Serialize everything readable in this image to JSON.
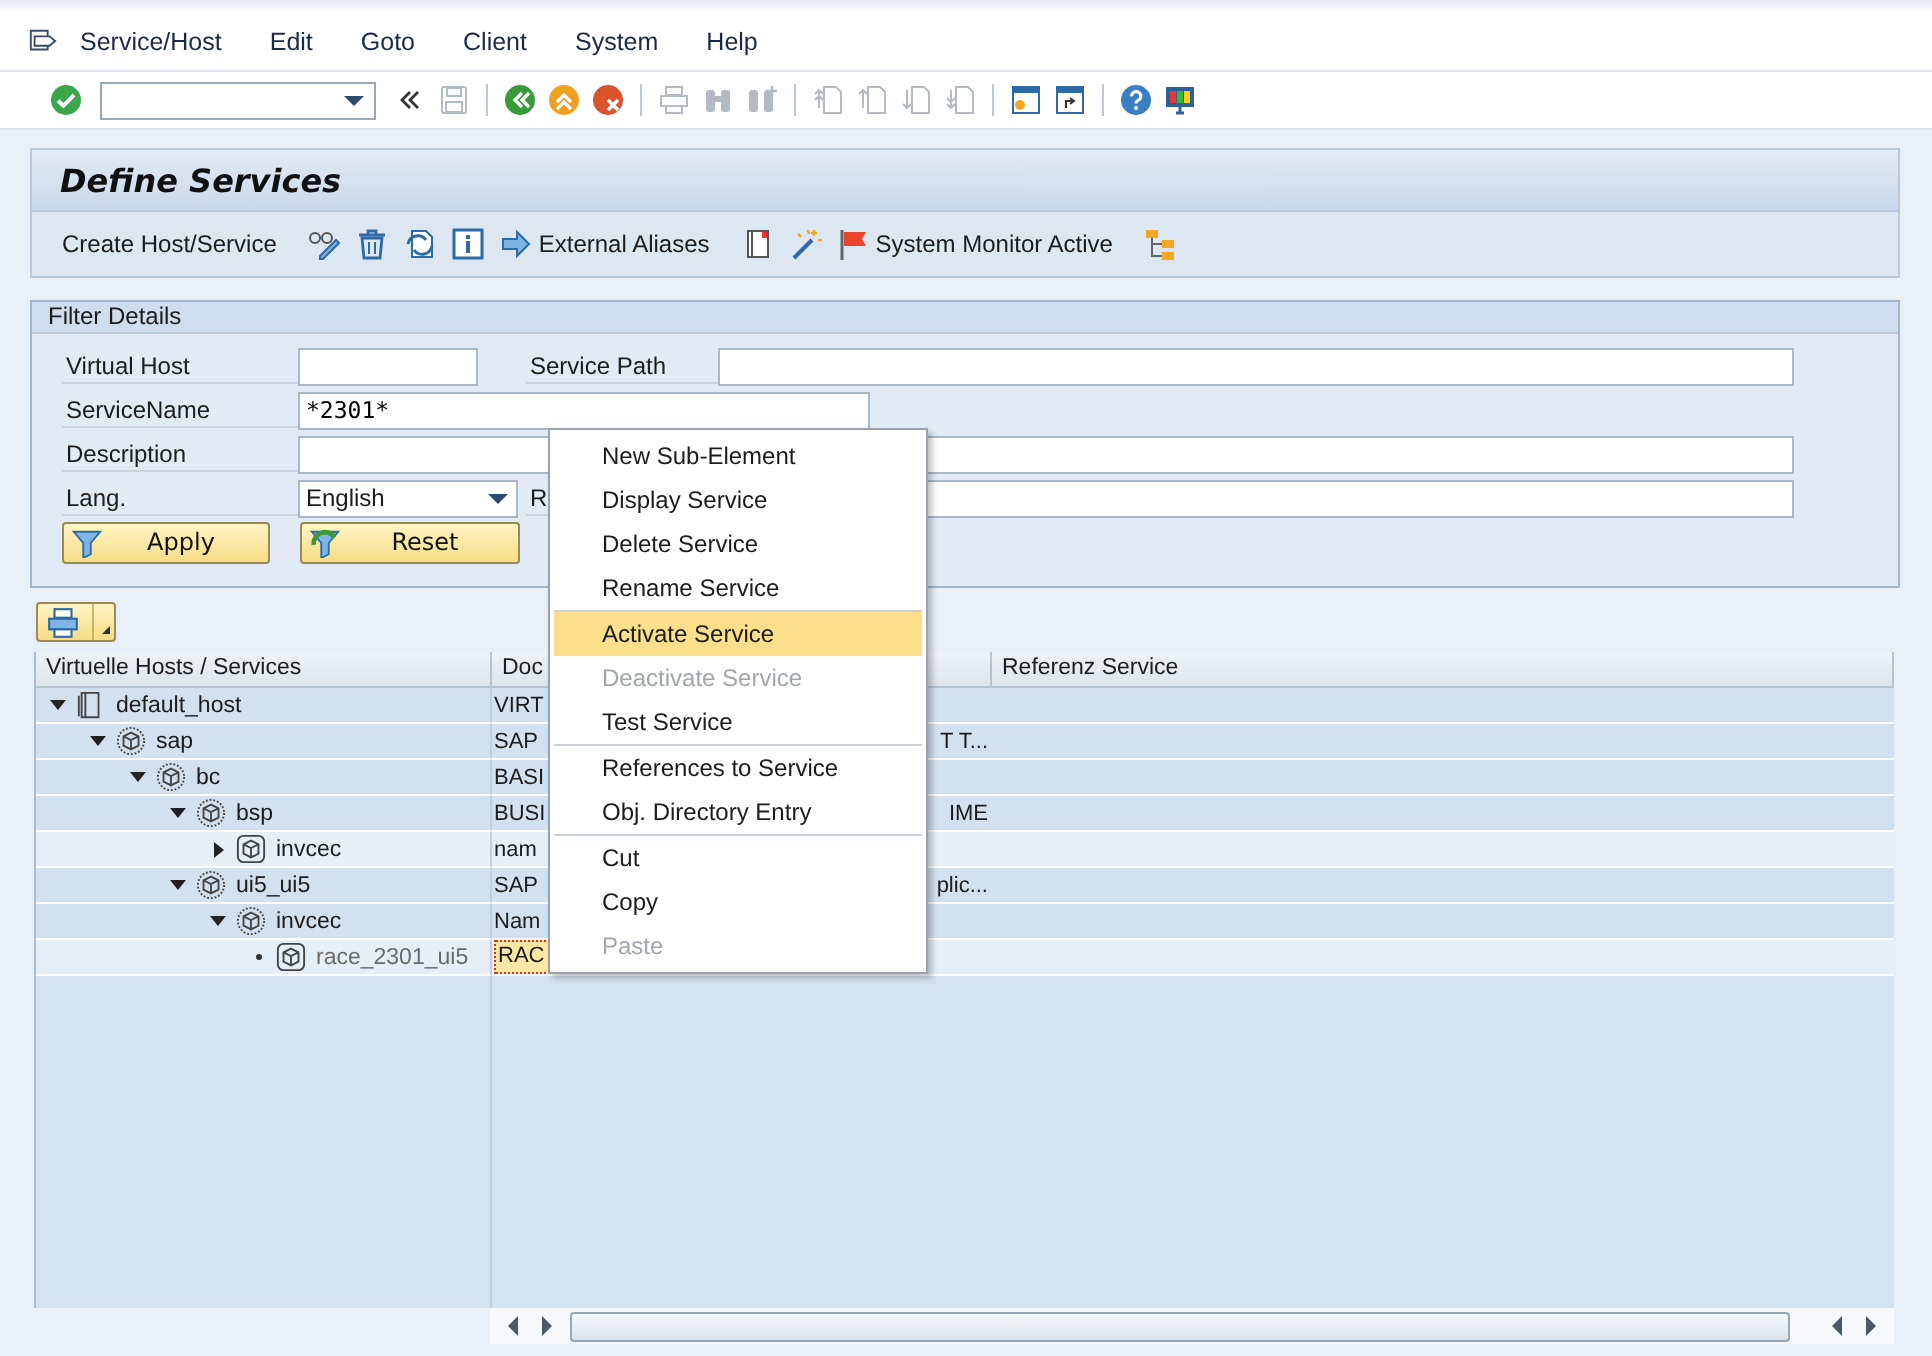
{
  "menu_bar": [
    {
      "label": "Service/Host"
    },
    {
      "label": "Edit"
    },
    {
      "label": "Goto"
    },
    {
      "label": "Client"
    },
    {
      "label": "System"
    },
    {
      "label": "Help"
    }
  ],
  "standard_toolbar": [
    {
      "kind": "ok",
      "disabled": false
    },
    {
      "kind": "command-field"
    },
    {
      "kind": "collapse",
      "disabled": false
    },
    {
      "kind": "save",
      "disabled": true
    },
    {
      "kind": "sep"
    },
    {
      "kind": "back",
      "disabled": false
    },
    {
      "kind": "exit",
      "disabled": false
    },
    {
      "kind": "cancel",
      "disabled": false
    },
    {
      "kind": "sep"
    },
    {
      "kind": "print",
      "disabled": true
    },
    {
      "kind": "find",
      "disabled": true
    },
    {
      "kind": "find-next",
      "disabled": true
    },
    {
      "kind": "sep"
    },
    {
      "kind": "first-page",
      "disabled": true
    },
    {
      "kind": "prev-page",
      "disabled": true
    },
    {
      "kind": "next-page",
      "disabled": true
    },
    {
      "kind": "last-page",
      "disabled": true
    },
    {
      "kind": "sep"
    },
    {
      "kind": "new-session",
      "disabled": false
    },
    {
      "kind": "shortcut",
      "disabled": false
    },
    {
      "kind": "sep"
    },
    {
      "kind": "help",
      "disabled": false
    },
    {
      "kind": "customize",
      "disabled": false
    }
  ],
  "screen": {
    "title": "Define Services",
    "app_toolbar": [
      {
        "kind": "text",
        "label": "Create Host/Service"
      },
      {
        "kind": "glasses-pencil"
      },
      {
        "kind": "trash"
      },
      {
        "kind": "refresh"
      },
      {
        "kind": "info"
      },
      {
        "kind": "arrow",
        "label": "External Aliases"
      },
      {
        "kind": "document"
      },
      {
        "kind": "wand"
      },
      {
        "kind": "flag",
        "label": "System Monitor Active"
      },
      {
        "kind": "hierarchy"
      }
    ],
    "filter": {
      "title": "Filter Details",
      "virtual_host": {
        "label": "Virtual Host"
      },
      "service_path": {
        "label": "Service Path"
      },
      "service_name": {
        "label": "ServiceName",
        "value": "*2301*"
      },
      "description": {
        "label": "Description"
      },
      "language": {
        "label": "Lang.",
        "value": "English"
      },
      "column_2_label": "R",
      "buttons": [
        {
          "kind": "apply",
          "label": "Apply"
        },
        {
          "kind": "reset",
          "label": "Reset"
        }
      ]
    },
    "tree": {
      "columns": [
        "Virtuelle Hosts / Services",
        "Doc",
        "Referenz Service"
      ],
      "nodes": [
        {
          "label": "default_host",
          "kind": "host",
          "expanded": true,
          "selected": true,
          "active": true,
          "column_2": [
            "VIRT"
          ],
          "children": [
            {
              "label": "sap",
              "kind": "node",
              "expanded": true,
              "selected": true,
              "active": true,
              "column_2": [
                "SAP",
                "T T..."
              ],
              "children": [
                {
                  "label": "bc",
                  "kind": "node",
                  "expanded": true,
                  "selected": true,
                  "active": true,
                  "column_2": [
                    "BASI"
                  ],
                  "children": [
                    {
                      "label": "bsp",
                      "kind": "node",
                      "expanded": true,
                      "selected": true,
                      "active": true,
                      "column_2": [
                        "BUSI",
                        "IME"
                      ],
                      "children": [
                        {
                          "label": "invcec",
                          "kind": "service",
                          "expanded": false,
                          "selected": false,
                          "active": true,
                          "column_2": [
                            "nam"
                          ]
                        }
                      ]
                    },
                    {
                      "label": "ui5_ui5",
                      "kind": "node",
                      "expanded": true,
                      "selected": true,
                      "active": true,
                      "column_2": [
                        "SAP",
                        "plic..."
                      ],
                      "children": [
                        {
                          "label": "invcec",
                          "kind": "node",
                          "expanded": true,
                          "selected": true,
                          "active": true,
                          "column_2": [
                            "Nam"
                          ],
                          "children": [
                            {
                              "label": "race_2301_ui5",
                              "kind": "service",
                              "selected": false,
                              "focused": true,
                              "active": false,
                              "column_2": [
                                "RAC"
                              ]
                            }
                          ]
                        }
                      ]
                    }
                  ]
                }
              ]
            }
          ]
        }
      ]
    }
  },
  "context_menu": [
    [
      {
        "label": "New Sub-Element",
        "disabled": false,
        "selected": false
      },
      {
        "label": "Display Service",
        "disabled": false,
        "selected": false
      },
      {
        "label": "Delete Service",
        "disabled": false,
        "selected": false
      },
      {
        "label": "Rename Service",
        "disabled": false,
        "selected": false
      }
    ],
    [
      {
        "label": "Activate Service",
        "disabled": false,
        "selected": true
      },
      {
        "label": "Deactivate Service",
        "disabled": true,
        "selected": false
      },
      {
        "label": "Test Service",
        "disabled": false,
        "selected": false
      }
    ],
    [
      {
        "label": "References to Service",
        "disabled": false,
        "selected": false
      },
      {
        "label": "Obj. Directory Entry",
        "disabled": false,
        "selected": false
      }
    ],
    [
      {
        "label": "Cut",
        "disabled": false,
        "selected": false
      },
      {
        "label": "Copy",
        "disabled": false,
        "selected": false
      },
      {
        "label": "Paste",
        "disabled": true,
        "selected": false
      }
    ]
  ]
}
